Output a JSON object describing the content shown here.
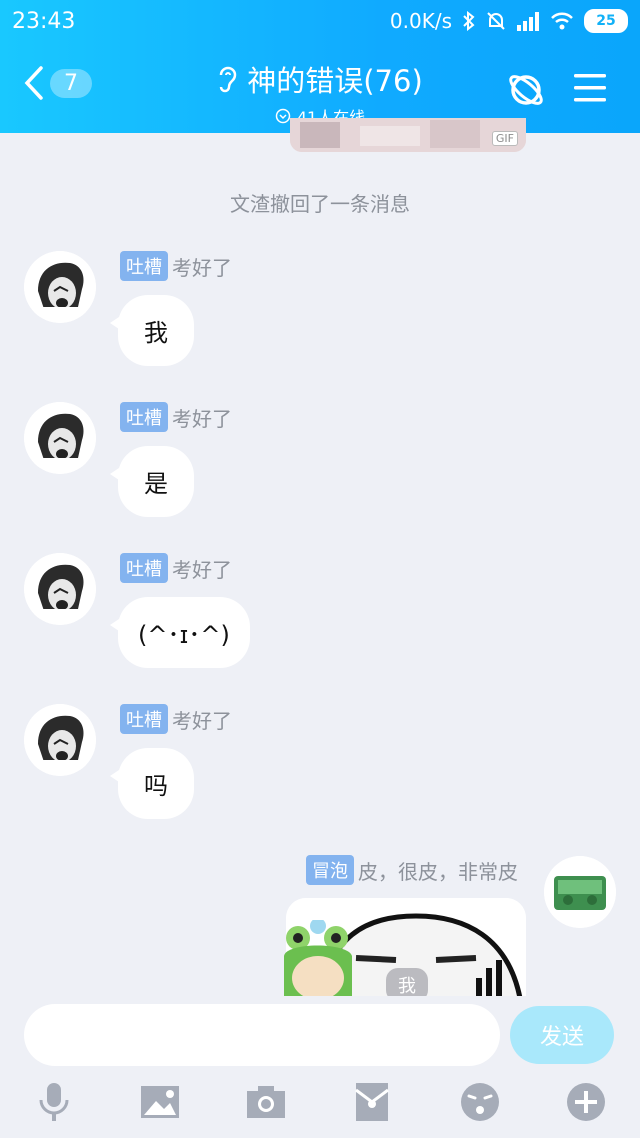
{
  "status_bar": {
    "time": "23:43",
    "net_speed": "0.0K/s",
    "battery": "25"
  },
  "header": {
    "back_badge": "7",
    "title": "神的错误(76)",
    "online": "41人在线"
  },
  "system_message": "文渣撤回了一条消息",
  "messages": [
    {
      "tag": "吐槽",
      "nick": "考好了",
      "text": "我"
    },
    {
      "tag": "吐槽",
      "nick": "考好了",
      "text": "是"
    },
    {
      "tag": "吐槽",
      "nick": "考好了",
      "text": "(^･ɪ･^)"
    },
    {
      "tag": "吐槽",
      "nick": "考好了",
      "text": "吗"
    }
  ],
  "my_message": {
    "tag": "冒泡",
    "nick": "皮，很皮，非常皮",
    "caption": "我",
    "gif_tag": "GIF"
  },
  "input": {
    "placeholder": "",
    "send_label": "发送"
  },
  "colors": {
    "header": "#10aaff",
    "tag": "#83b3ef",
    "send": "#a9e8fb",
    "background": "#eef0f6"
  }
}
